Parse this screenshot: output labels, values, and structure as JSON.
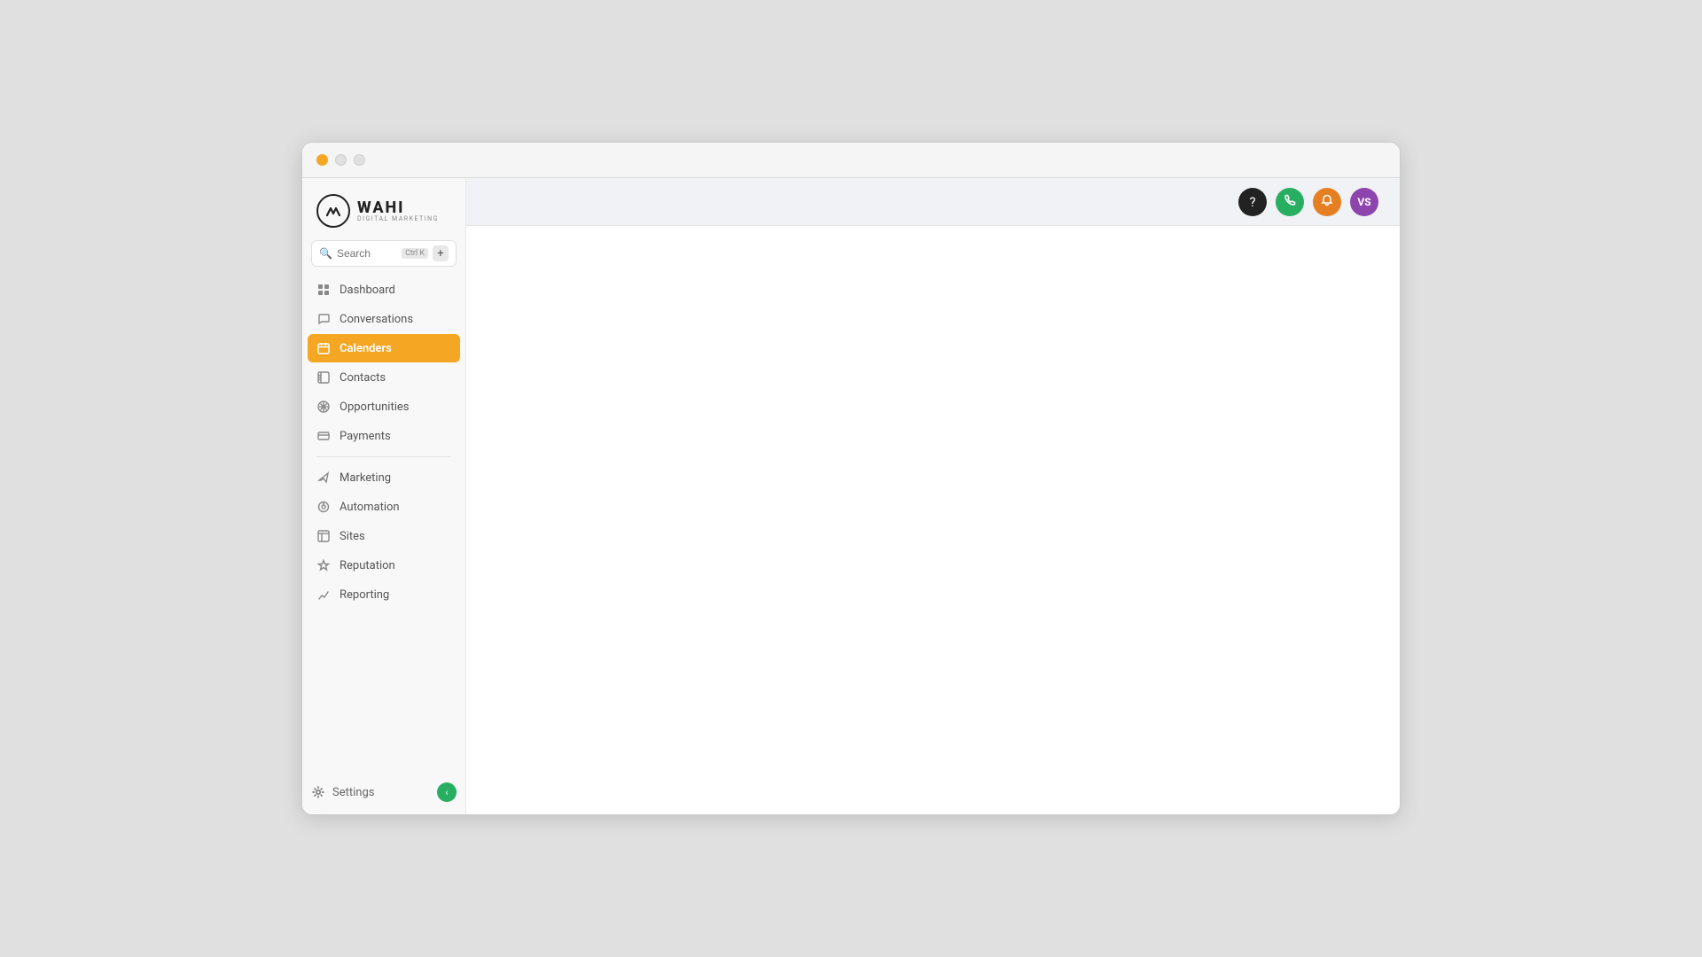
{
  "window": {
    "title": "Wahi Digital Marketing"
  },
  "logo": {
    "main": "WAHI",
    "sub": "DIGITAL MARKETING",
    "icon_letter": "W"
  },
  "search": {
    "placeholder": "Search",
    "shortcut": "Ctrl",
    "shortcut_display": "Ctrl K"
  },
  "nav": {
    "primary": [
      {
        "id": "dashboard",
        "label": "Dashboard",
        "icon": "grid"
      },
      {
        "id": "conversations",
        "label": "Conversations",
        "icon": "chat"
      },
      {
        "id": "calenders",
        "label": "Calenders",
        "icon": "calendar",
        "active": true
      },
      {
        "id": "contacts",
        "label": "Contacts",
        "icon": "contacts"
      },
      {
        "id": "opportunities",
        "label": "Opportunities",
        "icon": "asterisk"
      },
      {
        "id": "payments",
        "label": "Payments",
        "icon": "payments"
      }
    ],
    "secondary": [
      {
        "id": "marketing",
        "label": "Marketing",
        "icon": "send"
      },
      {
        "id": "automation",
        "label": "Automation",
        "icon": "automation"
      },
      {
        "id": "sites",
        "label": "Sites",
        "icon": "sites"
      },
      {
        "id": "reputation",
        "label": "Reputation",
        "icon": "star"
      },
      {
        "id": "reporting",
        "label": "Reporting",
        "icon": "chart"
      }
    ]
  },
  "bottom": {
    "settings_label": "Settings"
  },
  "header": {
    "help_label": "?",
    "phone_label": "📞",
    "bell_label": "🔔",
    "avatar_label": "VS"
  }
}
